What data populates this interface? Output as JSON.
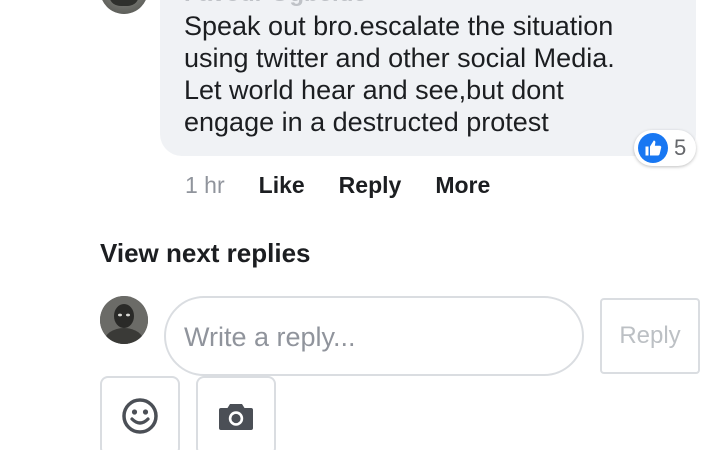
{
  "comment": {
    "author": "Favour Ogbeide",
    "text": "Speak out bro.escalate the situation\nusing twitter and other social Media.\nLet world hear and see,but dont\nengage in a destructed protest",
    "reaction_icon": "like-icon",
    "reaction_count": "5",
    "timestamp": "1 hr",
    "actions": {
      "like": "Like",
      "reply": "Reply",
      "more": "More"
    }
  },
  "replies": {
    "view_next_label": "View next replies"
  },
  "composer": {
    "placeholder": "Write a reply...",
    "submit_label": "Reply",
    "tools": [
      "emoji-icon",
      "camera-icon"
    ]
  },
  "colors": {
    "bubble_bg": "#f0f2f5",
    "like_blue": "#1877f2",
    "text_primary": "#1c1e21",
    "text_secondary": "#90949c",
    "border": "#dadde1",
    "icon_dark": "#4b4f56"
  }
}
